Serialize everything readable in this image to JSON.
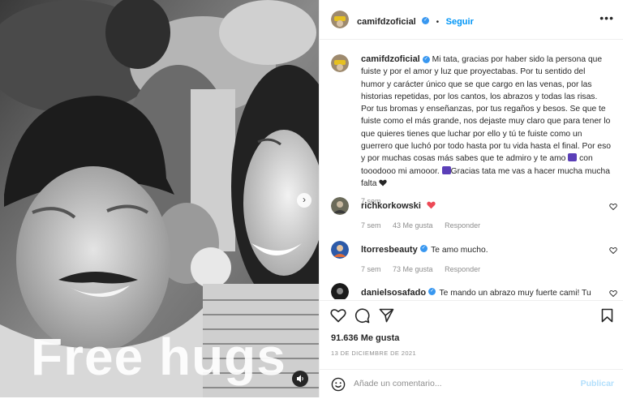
{
  "media": {
    "overlay_text": "Free hugs"
  },
  "header": {
    "username": "camifdzoficial",
    "separator": "•",
    "follow_label": "Seguir",
    "more_label": "•••"
  },
  "caption": {
    "username": "camifdzoficial",
    "text_1": "Mi tata, gracias por haber sido la persona que fuiste y por el amor y luz que proyectabas. Por tu sentido del humor y carácter único que se que cargo en las venas, por las historias repetidas, por los cantos, los abrazos y todas las risas. Por tus bromas y enseñanzas, por tus regaños y besos. Se que te fuiste como el más grande, nos dejaste muy claro que para tener lo que quieres tienes que luchar por ello y tú te fuiste como un guerrero que luchó por todo hasta por tu vida hasta el final. Por eso y por muchas cosas más sabes que te admiro y te amo",
    "text_2": "con tooodooo mi amooor.",
    "text_3": "Gracias tata me vas a hacer mucha mucha falta",
    "time": "7 sem"
  },
  "comments": [
    {
      "username": "richkorkowski",
      "text": "",
      "time": "7 sem",
      "likes": "43 Me gusta",
      "reply": "Responder",
      "verified": false
    },
    {
      "username": "ltorresbeauty",
      "text": "Te amo mucho.",
      "time": "7 sem",
      "likes": "73 Me gusta",
      "reply": "Responder",
      "verified": true
    },
    {
      "username": "danielsosafado",
      "text": "Te mando un abrazo muy fuerte cami! Tu",
      "verified": true
    }
  ],
  "actions": {
    "likes": "91.636 Me gusta",
    "date": "13 DE DICIEMBRE DE 2021"
  },
  "add_comment": {
    "placeholder": "Añade un comentario...",
    "publish_label": "Publicar"
  },
  "colors": {
    "link": "#0095f6",
    "heart": "#ed4956",
    "verified": "#3897f0"
  },
  "icons": [
    "verified-icon",
    "heart-icon",
    "comment-icon",
    "share-icon",
    "bookmark-icon",
    "emoji-icon",
    "sound-icon",
    "chevron-right-icon"
  ]
}
